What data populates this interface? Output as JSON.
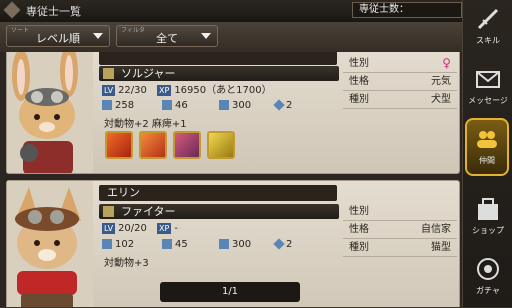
{
  "header": {
    "title": "専従士一覧",
    "count_label": "専従士数："
  },
  "filters": {
    "sort": {
      "caption": "ソート",
      "value": "レベル順"
    },
    "filter": {
      "caption": "フィルタ",
      "value": "全て"
    }
  },
  "units": [
    {
      "name": "",
      "job": "ソルジャー",
      "level": "22/30",
      "xp": "16950（あと1700）",
      "stats": [
        "258",
        "46",
        "300",
        "2"
      ],
      "extra": "対動物+2  麻痺+1",
      "attrs": [
        {
          "key": "性別",
          "value": "♀"
        },
        {
          "key": "性格",
          "value": "元気"
        },
        {
          "key": "種別",
          "value": "犬型"
        }
      ]
    },
    {
      "name": "エリン",
      "job": "ファイター",
      "level": "20/20",
      "xp": "-",
      "stats": [
        "102",
        "45",
        "300",
        "2"
      ],
      "extra": "対動物+3",
      "attrs": [
        {
          "key": "性別",
          "value": ""
        },
        {
          "key": "性格",
          "value": "自信家"
        },
        {
          "key": "種別",
          "value": "猫型"
        }
      ]
    }
  ],
  "labels": {
    "lv": "LV",
    "xp": "XP"
  },
  "pager": "1/1",
  "nav": [
    {
      "label": "スキル",
      "icon": "sword-icon"
    },
    {
      "label": "メッセージ",
      "icon": "envelope-icon"
    },
    {
      "label": "仲間",
      "icon": "people-icon"
    },
    {
      "label": "ショップ",
      "icon": "shop-icon"
    },
    {
      "label": "ガチャ",
      "icon": "gacha-icon"
    }
  ]
}
